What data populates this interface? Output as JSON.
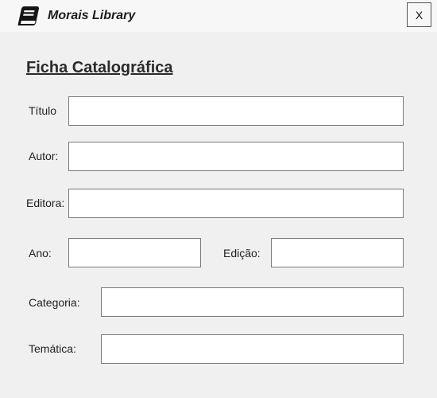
{
  "window": {
    "title": "Morais Library",
    "close_label": "X"
  },
  "form": {
    "heading": "Ficha Catalográfica",
    "fields": {
      "titulo": {
        "label": "Título",
        "value": ""
      },
      "autor": {
        "label": "Autor:",
        "value": ""
      },
      "editora": {
        "label": "Editora:",
        "value": ""
      },
      "ano": {
        "label": "Ano:",
        "value": ""
      },
      "edicao": {
        "label": "Edição:",
        "value": ""
      },
      "categoria": {
        "label": "Categoria:",
        "value": ""
      },
      "tematica": {
        "label": "Temática:",
        "value": ""
      }
    }
  },
  "icons": {
    "app": "book-icon"
  }
}
